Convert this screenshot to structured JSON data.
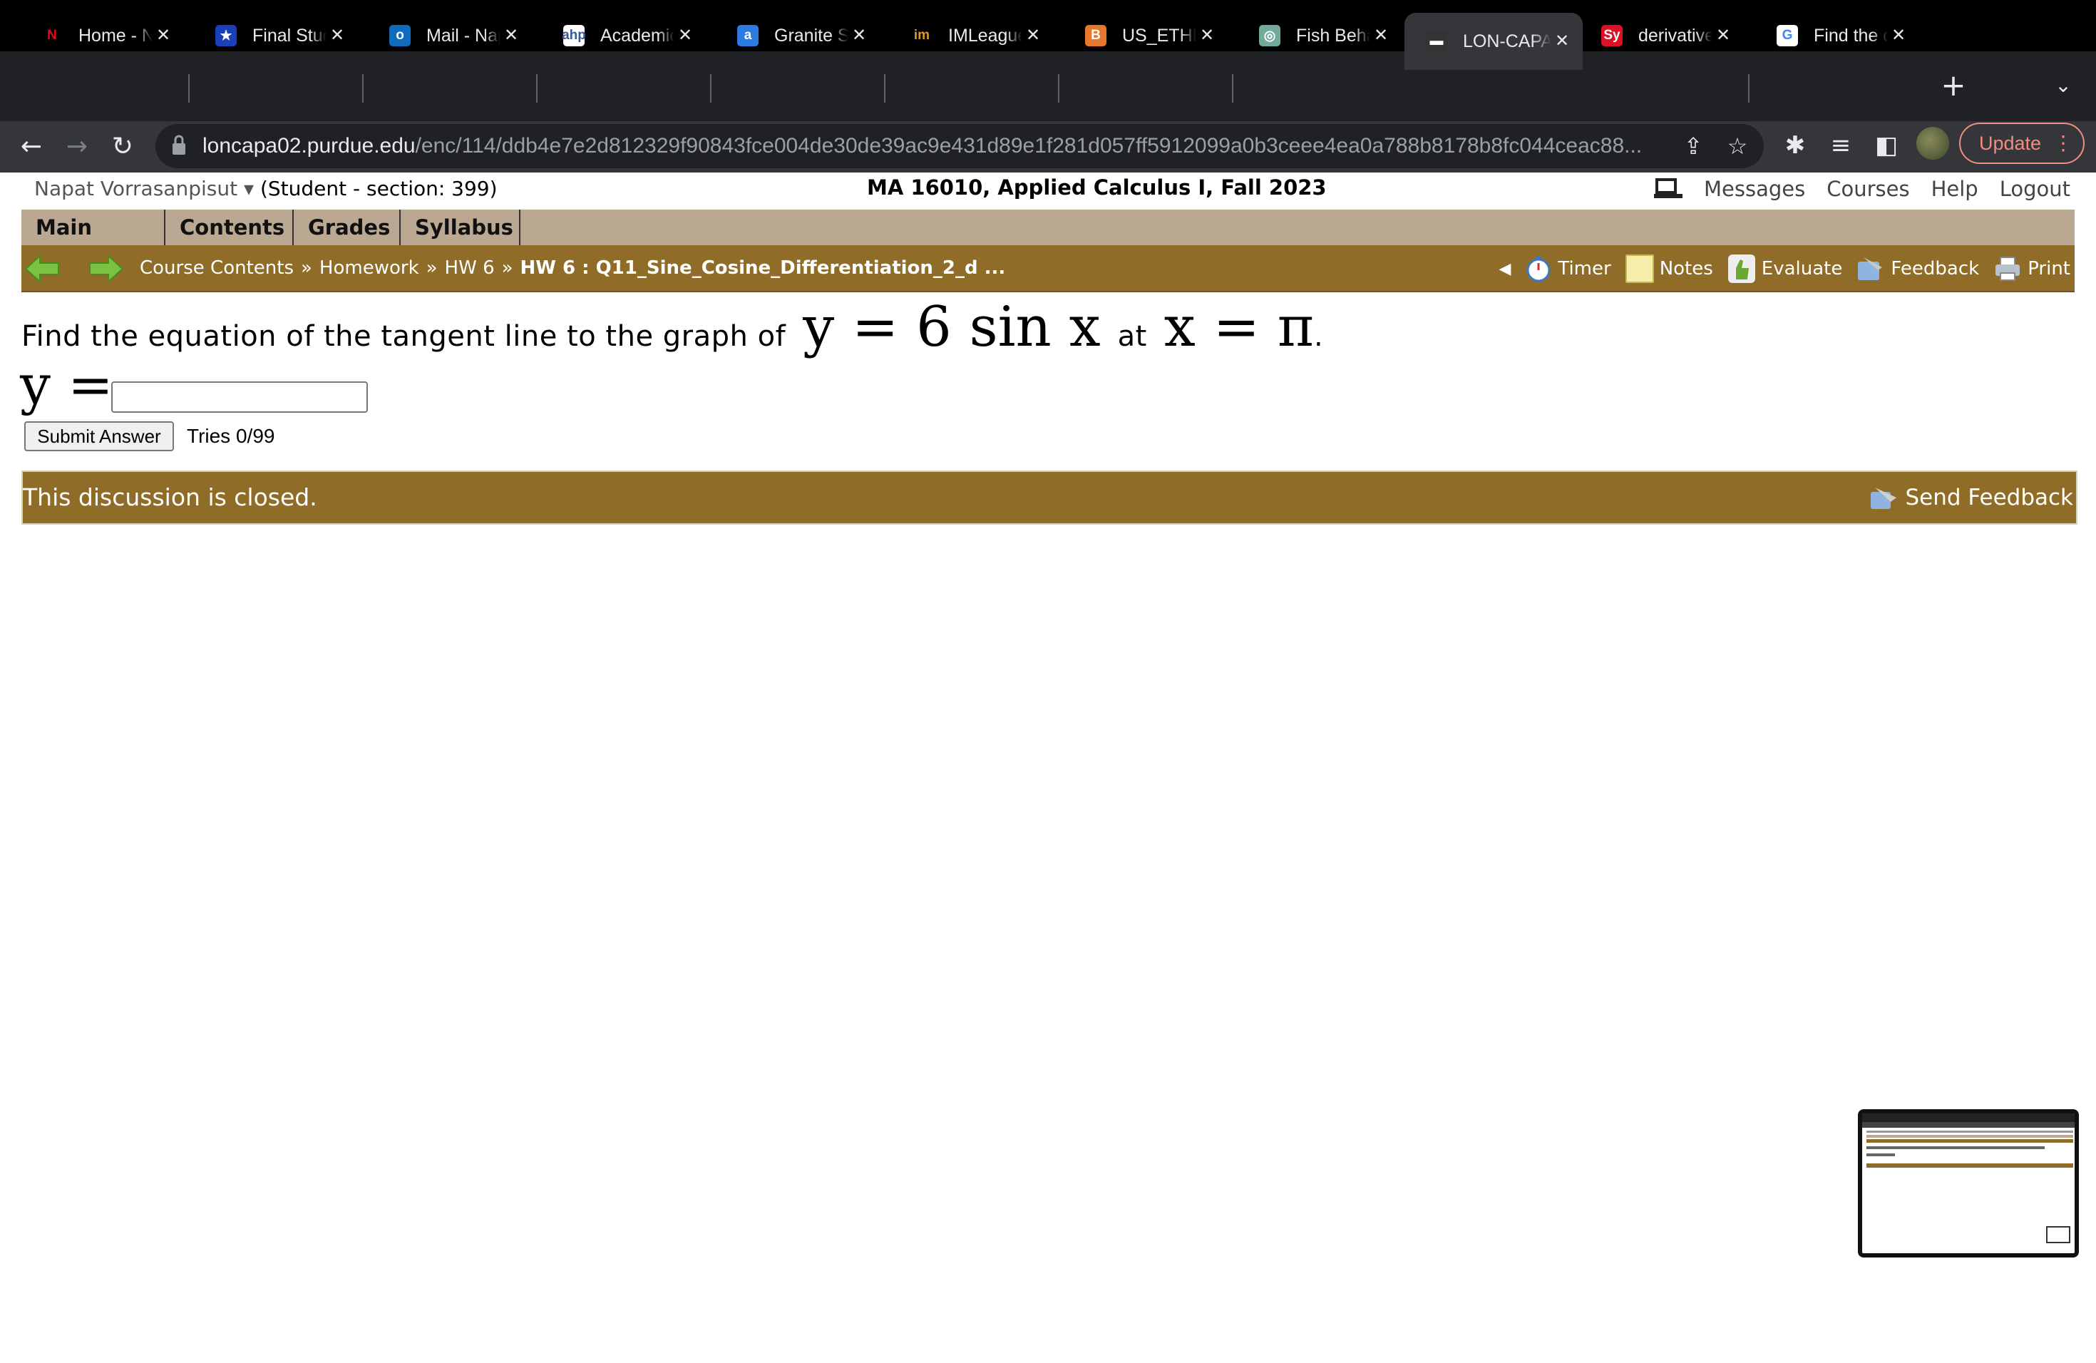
{
  "browser": {
    "tabs": [
      {
        "title": "Home - Netflix",
        "favicon": "N",
        "color": "#e50914",
        "bg": "transparent"
      },
      {
        "title": "Final Study Guide",
        "favicon": "★",
        "color": "#fff",
        "bg": "#1a3fb8"
      },
      {
        "title": "Mail - Napat",
        "favicon": "o",
        "color": "#fff",
        "bg": "#0f6cbd"
      },
      {
        "title": "Academic",
        "favicon": "ahp",
        "color": "#3b5998",
        "bg": "#fff"
      },
      {
        "title": "Granite State",
        "favicon": "a",
        "color": "#fff",
        "bg": "#2c7be5"
      },
      {
        "title": "IMLeagues",
        "favicon": "im",
        "color": "#d79b2b",
        "bg": "transparent"
      },
      {
        "title": "US_ETHNIC",
        "favicon": "B",
        "color": "#fff",
        "bg": "#e8772e"
      },
      {
        "title": "Fish Behavior",
        "favicon": "◎",
        "color": "#fff",
        "bg": "#74aa9c"
      },
      {
        "title": "LON-CAPA",
        "favicon": "▬",
        "color": "#fff",
        "bg": "#333"
      },
      {
        "title": "derivative",
        "favicon": "Sy",
        "color": "#fff",
        "bg": "#dd1124"
      },
      {
        "title": "Find the d",
        "favicon": "G",
        "color": "#4285f4",
        "bg": "#fff"
      }
    ],
    "url_host": "loncapa02.purdue.edu",
    "url_path": "/enc/114/ddb4e7e2d812329f90843fce004de30de39ac9e431d89e1f281d057ff5912099a0b3ceee4ea0a788b8178b8fc044ceac88...",
    "update_label": "Update"
  },
  "header": {
    "user_name": "Napat Vorrasanpisut",
    "user_caret": "▾",
    "section": "(Student  - section: 399)",
    "course_title": "MA 16010, Applied Calculus I, Fall 2023",
    "links": [
      "Messages",
      "Courses",
      "Help",
      "Logout"
    ]
  },
  "main_menu": [
    "Main Menu",
    "Contents",
    "Grades",
    "Syllabus"
  ],
  "breadcrumb": {
    "items": [
      "Course Contents",
      "Homework",
      "HW 6"
    ],
    "current": "HW 6 : Q11_Sine_Cosine_Differentiation_2_d ...",
    "separator": "»"
  },
  "tools": [
    "Timer",
    "Notes",
    "Evaluate",
    "Feedback",
    "Print"
  ],
  "question": {
    "prefix": "Find the equation of the tangent line to the graph of",
    "function": "y = 6 sin x",
    "middle": "at",
    "point": "x = π",
    "suffix": "."
  },
  "answer": {
    "label": "y =",
    "value": "",
    "submit_label": "Submit Answer",
    "tries": "Tries 0/99"
  },
  "discussion": {
    "status": "This discussion is closed.",
    "feedback_label": "Send Feedback"
  }
}
